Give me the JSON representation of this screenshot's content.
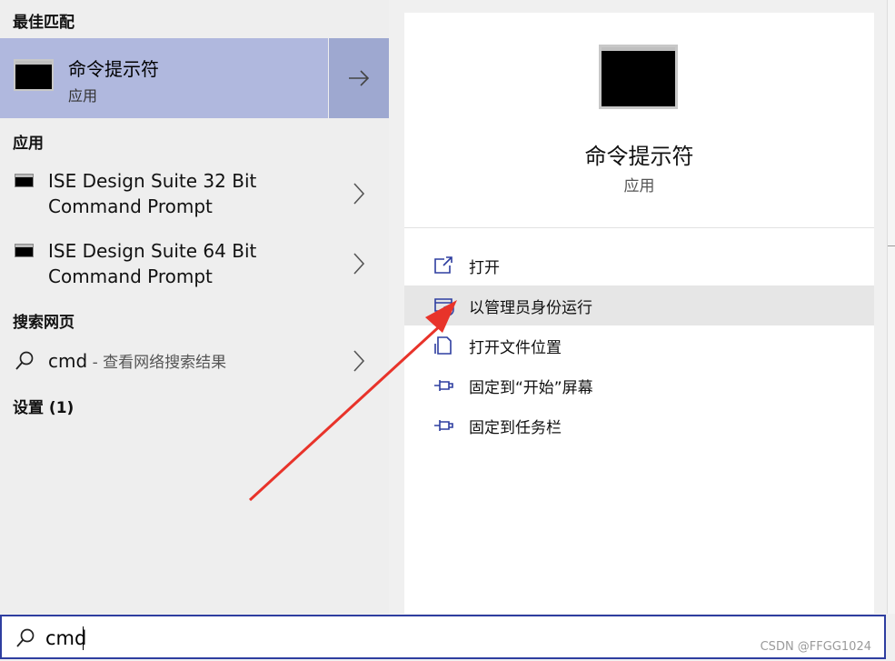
{
  "sections": {
    "best_match": "最佳匹配",
    "apps": "应用",
    "web": "搜索网页",
    "settings": "设置 (1)"
  },
  "best_match": {
    "title": "命令提示符",
    "subtitle": "应用"
  },
  "apps": [
    {
      "line1": "ISE Design Suite 32 Bit",
      "line2": "Command Prompt"
    },
    {
      "line1": "ISE Design Suite 64 Bit",
      "line2": "Command Prompt"
    }
  ],
  "web": {
    "query": "cmd",
    "hint": " - 查看网络搜索结果"
  },
  "detail": {
    "title": "命令提示符",
    "subtitle": "应用",
    "actions": [
      {
        "label": "打开",
        "icon": "open-icon"
      },
      {
        "label": "以管理员身份运行",
        "icon": "shield-admin-icon",
        "highlighted": true
      },
      {
        "label": "打开文件位置",
        "icon": "file-location-icon"
      },
      {
        "label": "固定到“开始”屏幕",
        "icon": "pin-icon"
      },
      {
        "label": "固定到任务栏",
        "icon": "pin-icon"
      }
    ]
  },
  "search": {
    "value": "cmd"
  },
  "watermark": "CSDN @FFGG1024",
  "colors": {
    "selection": "#b0b8de",
    "selection_arrow": "#9ea8d0",
    "accent": "#2e3ea0",
    "annotation_arrow": "#e8332a"
  }
}
